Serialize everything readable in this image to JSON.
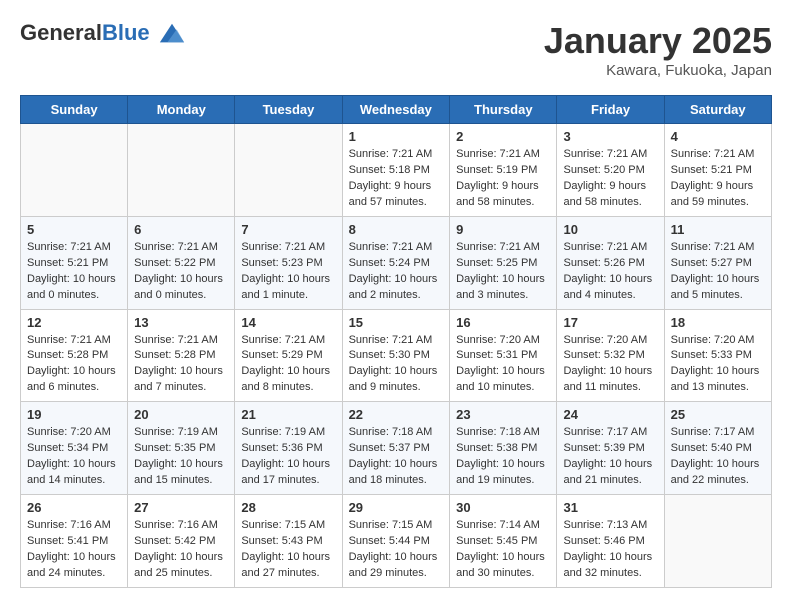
{
  "logo": {
    "general": "General",
    "blue": "Blue"
  },
  "header": {
    "month": "January 2025",
    "location": "Kawara, Fukuoka, Japan"
  },
  "weekdays": [
    "Sunday",
    "Monday",
    "Tuesday",
    "Wednesday",
    "Thursday",
    "Friday",
    "Saturday"
  ],
  "weeks": [
    [
      {
        "day": "",
        "info": ""
      },
      {
        "day": "",
        "info": ""
      },
      {
        "day": "",
        "info": ""
      },
      {
        "day": "1",
        "info": "Sunrise: 7:21 AM\nSunset: 5:18 PM\nDaylight: 9 hours\nand 57 minutes."
      },
      {
        "day": "2",
        "info": "Sunrise: 7:21 AM\nSunset: 5:19 PM\nDaylight: 9 hours\nand 58 minutes."
      },
      {
        "day": "3",
        "info": "Sunrise: 7:21 AM\nSunset: 5:20 PM\nDaylight: 9 hours\nand 58 minutes."
      },
      {
        "day": "4",
        "info": "Sunrise: 7:21 AM\nSunset: 5:21 PM\nDaylight: 9 hours\nand 59 minutes."
      }
    ],
    [
      {
        "day": "5",
        "info": "Sunrise: 7:21 AM\nSunset: 5:21 PM\nDaylight: 10 hours\nand 0 minutes."
      },
      {
        "day": "6",
        "info": "Sunrise: 7:21 AM\nSunset: 5:22 PM\nDaylight: 10 hours\nand 0 minutes."
      },
      {
        "day": "7",
        "info": "Sunrise: 7:21 AM\nSunset: 5:23 PM\nDaylight: 10 hours\nand 1 minute."
      },
      {
        "day": "8",
        "info": "Sunrise: 7:21 AM\nSunset: 5:24 PM\nDaylight: 10 hours\nand 2 minutes."
      },
      {
        "day": "9",
        "info": "Sunrise: 7:21 AM\nSunset: 5:25 PM\nDaylight: 10 hours\nand 3 minutes."
      },
      {
        "day": "10",
        "info": "Sunrise: 7:21 AM\nSunset: 5:26 PM\nDaylight: 10 hours\nand 4 minutes."
      },
      {
        "day": "11",
        "info": "Sunrise: 7:21 AM\nSunset: 5:27 PM\nDaylight: 10 hours\nand 5 minutes."
      }
    ],
    [
      {
        "day": "12",
        "info": "Sunrise: 7:21 AM\nSunset: 5:28 PM\nDaylight: 10 hours\nand 6 minutes."
      },
      {
        "day": "13",
        "info": "Sunrise: 7:21 AM\nSunset: 5:28 PM\nDaylight: 10 hours\nand 7 minutes."
      },
      {
        "day": "14",
        "info": "Sunrise: 7:21 AM\nSunset: 5:29 PM\nDaylight: 10 hours\nand 8 minutes."
      },
      {
        "day": "15",
        "info": "Sunrise: 7:21 AM\nSunset: 5:30 PM\nDaylight: 10 hours\nand 9 minutes."
      },
      {
        "day": "16",
        "info": "Sunrise: 7:20 AM\nSunset: 5:31 PM\nDaylight: 10 hours\nand 10 minutes."
      },
      {
        "day": "17",
        "info": "Sunrise: 7:20 AM\nSunset: 5:32 PM\nDaylight: 10 hours\nand 11 minutes."
      },
      {
        "day": "18",
        "info": "Sunrise: 7:20 AM\nSunset: 5:33 PM\nDaylight: 10 hours\nand 13 minutes."
      }
    ],
    [
      {
        "day": "19",
        "info": "Sunrise: 7:20 AM\nSunset: 5:34 PM\nDaylight: 10 hours\nand 14 minutes."
      },
      {
        "day": "20",
        "info": "Sunrise: 7:19 AM\nSunset: 5:35 PM\nDaylight: 10 hours\nand 15 minutes."
      },
      {
        "day": "21",
        "info": "Sunrise: 7:19 AM\nSunset: 5:36 PM\nDaylight: 10 hours\nand 17 minutes."
      },
      {
        "day": "22",
        "info": "Sunrise: 7:18 AM\nSunset: 5:37 PM\nDaylight: 10 hours\nand 18 minutes."
      },
      {
        "day": "23",
        "info": "Sunrise: 7:18 AM\nSunset: 5:38 PM\nDaylight: 10 hours\nand 19 minutes."
      },
      {
        "day": "24",
        "info": "Sunrise: 7:17 AM\nSunset: 5:39 PM\nDaylight: 10 hours\nand 21 minutes."
      },
      {
        "day": "25",
        "info": "Sunrise: 7:17 AM\nSunset: 5:40 PM\nDaylight: 10 hours\nand 22 minutes."
      }
    ],
    [
      {
        "day": "26",
        "info": "Sunrise: 7:16 AM\nSunset: 5:41 PM\nDaylight: 10 hours\nand 24 minutes."
      },
      {
        "day": "27",
        "info": "Sunrise: 7:16 AM\nSunset: 5:42 PM\nDaylight: 10 hours\nand 25 minutes."
      },
      {
        "day": "28",
        "info": "Sunrise: 7:15 AM\nSunset: 5:43 PM\nDaylight: 10 hours\nand 27 minutes."
      },
      {
        "day": "29",
        "info": "Sunrise: 7:15 AM\nSunset: 5:44 PM\nDaylight: 10 hours\nand 29 minutes."
      },
      {
        "day": "30",
        "info": "Sunrise: 7:14 AM\nSunset: 5:45 PM\nDaylight: 10 hours\nand 30 minutes."
      },
      {
        "day": "31",
        "info": "Sunrise: 7:13 AM\nSunset: 5:46 PM\nDaylight: 10 hours\nand 32 minutes."
      },
      {
        "day": "",
        "info": ""
      }
    ]
  ]
}
